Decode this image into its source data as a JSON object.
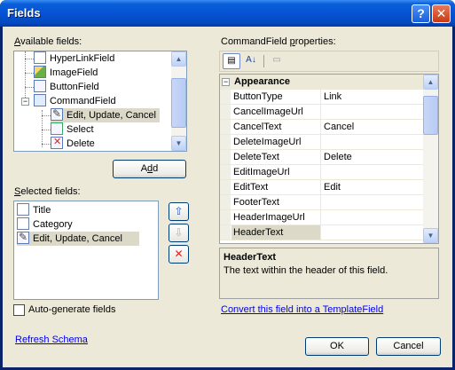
{
  "window": {
    "title": "Fields",
    "help_glyph": "?",
    "close_glyph": "✕"
  },
  "available": {
    "label_prefix": "",
    "label_ul": "A",
    "label_rest": "vailable fields:",
    "items": [
      {
        "label": "HyperLinkField",
        "icon": "hyperlink-field-icon"
      },
      {
        "label": "ImageField",
        "icon": "image-field-icon"
      },
      {
        "label": "ButtonField",
        "icon": "button-field-icon"
      },
      {
        "label": "CommandField",
        "icon": "command-field-icon",
        "expander": "−"
      },
      {
        "label": "Edit, Update, Cancel",
        "icon": "edit-update-cancel-icon",
        "selected": true
      },
      {
        "label": "Select",
        "icon": "select-icon"
      },
      {
        "label": "Delete",
        "icon": "delete-icon"
      }
    ],
    "add_prefix": "A",
    "add_ul": "d",
    "add_rest": "d"
  },
  "selected": {
    "label_ul": "S",
    "label_rest": "elected fields:",
    "items": [
      {
        "label": "Title",
        "icon": "bound-field-icon"
      },
      {
        "label": "Category",
        "icon": "bound-field-icon"
      },
      {
        "label": "Edit, Update, Cancel",
        "icon": "command-field-icon",
        "selected": true
      }
    ],
    "move_up_glyph": "⇧",
    "move_down_glyph": "⇩",
    "delete_glyph": "✕"
  },
  "autogen": {
    "label_prefix": "Auto-",
    "label_ul": "g",
    "label_rest": "enerate fields",
    "checked": false
  },
  "refresh_schema_label": "Refresh Schema",
  "properties": {
    "label_prefix": "CommandField ",
    "label_ul": "p",
    "label_rest": "roperties:",
    "category_label": "Appearance",
    "category_expander": "−",
    "rows": [
      {
        "name": "ButtonType",
        "value": "Link"
      },
      {
        "name": "CancelImageUrl",
        "value": ""
      },
      {
        "name": "CancelText",
        "value": "Cancel"
      },
      {
        "name": "DeleteImageUrl",
        "value": ""
      },
      {
        "name": "DeleteText",
        "value": "Delete"
      },
      {
        "name": "EditImageUrl",
        "value": ""
      },
      {
        "name": "EditText",
        "value": "Edit"
      },
      {
        "name": "FooterText",
        "value": ""
      },
      {
        "name": "HeaderImageUrl",
        "value": ""
      },
      {
        "name": "HeaderText",
        "value": "",
        "selected": true
      }
    ],
    "description_title": "HeaderText",
    "description_text": "The text within the header of this field."
  },
  "convert_link_label": "Convert this field into a TemplateField",
  "ok_label": "OK",
  "cancel_label": "Cancel",
  "colors": {
    "titlebar": "#0553d4",
    "link": "#0000ee",
    "face": "#ece9d8",
    "selection": "#dcd9c8"
  }
}
